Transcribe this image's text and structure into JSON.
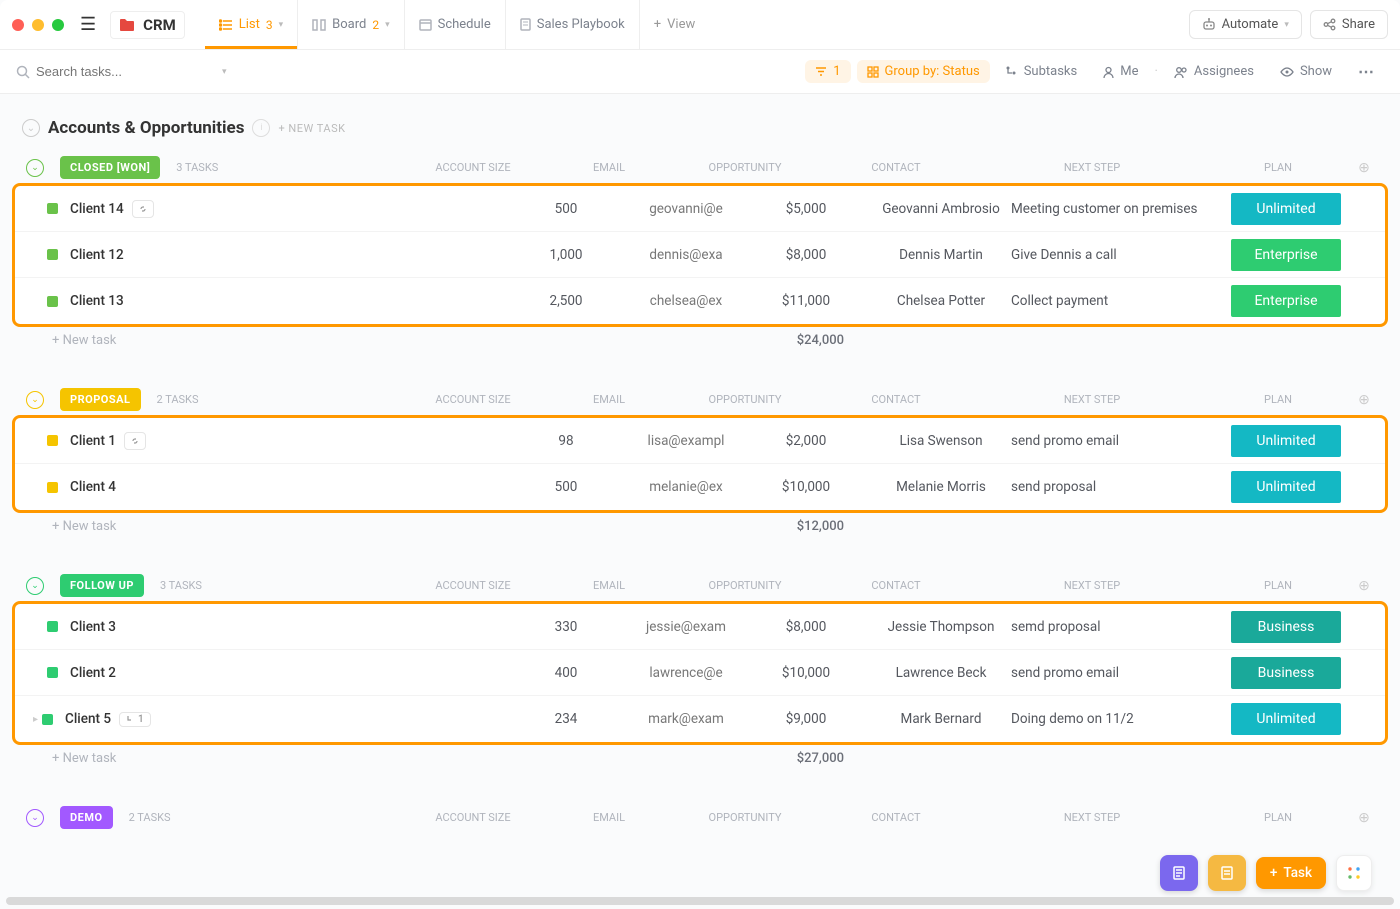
{
  "header": {
    "folder_name": "CRM",
    "views": {
      "list": {
        "label": "List",
        "count": "3"
      },
      "board": {
        "label": "Board",
        "count": "2"
      },
      "schedule": {
        "label": "Schedule"
      },
      "playbook": {
        "label": "Sales Playbook"
      },
      "addview": "View"
    },
    "automate_label": "Automate",
    "share_label": "Share"
  },
  "filter": {
    "search_placeholder": "Search tasks...",
    "filter_count": "1",
    "group_by": "Group by: Status",
    "subtasks": "Subtasks",
    "me": "Me",
    "assignees": "Assignees",
    "show": "Show"
  },
  "page": {
    "title": "Accounts & Opportunities",
    "new_task_btn": "+ NEW TASK"
  },
  "cols": {
    "acct": "ACCOUNT SIZE",
    "email": "EMAIL",
    "opp": "OPPORTUNITY",
    "contact": "CONTACT",
    "next": "NEXT STEP",
    "plan": "PLAN"
  },
  "groups": [
    {
      "key": "closedwon",
      "status": "CLOSED [WON]",
      "status_color": "#6ac24a",
      "collapse_color": "#6ac24a",
      "tasks_label": "3 TASKS",
      "rows": [
        {
          "name": "Client 14",
          "link": true,
          "acct": "500",
          "email": "geovanni@e",
          "opp": "$5,000",
          "contact": "Geovanni Ambrosio",
          "next": "Meeting customer on premises",
          "plan": "Unlimited",
          "plan_type": "unlimited",
          "sq": "#6ac24a"
        },
        {
          "name": "Client 12",
          "acct": "1,000",
          "email": "dennis@exa",
          "opp": "$8,000",
          "contact": "Dennis Martin",
          "next": "Give Dennis a call",
          "plan": "Enterprise",
          "plan_type": "enterprise",
          "sq": "#6ac24a"
        },
        {
          "name": "Client 13",
          "acct": "2,500",
          "email": "chelsea@ex",
          "opp": "$11,000",
          "contact": "Chelsea Potter",
          "next": "Collect payment",
          "plan": "Enterprise",
          "plan_type": "enterprise",
          "sq": "#6ac24a"
        }
      ],
      "new_task": "+ New task",
      "total": "$24,000"
    },
    {
      "key": "proposal",
      "status": "PROPOSAL",
      "status_color": "#f5c400",
      "collapse_color": "#f5c400",
      "tasks_label": "2 TASKS",
      "rows": [
        {
          "name": "Client 1",
          "link": true,
          "acct": "98",
          "email": "lisa@exampl",
          "opp": "$2,000",
          "contact": "Lisa Swenson",
          "next": "send promo email",
          "plan": "Unlimited",
          "plan_type": "unlimited",
          "sq": "#f5c400"
        },
        {
          "name": "Client 4",
          "acct": "500",
          "email": "melanie@ex",
          "opp": "$10,000",
          "contact": "Melanie Morris",
          "next": "send proposal",
          "plan": "Unlimited",
          "plan_type": "unlimited",
          "sq": "#f5c400"
        }
      ],
      "new_task": "+ New task",
      "total": "$12,000"
    },
    {
      "key": "followup",
      "status": "FOLLOW UP",
      "status_color": "#2ecc71",
      "collapse_color": "#2ecc71",
      "tasks_label": "3 TASKS",
      "rows": [
        {
          "name": "Client 3",
          "acct": "330",
          "email": "jessie@exam",
          "opp": "$8,000",
          "contact": "Jessie Thompson",
          "next": "semd proposal",
          "plan": "Business",
          "plan_type": "business",
          "sq": "#2ecc71"
        },
        {
          "name": "Client 2",
          "acct": "400",
          "email": "lawrence@e",
          "opp": "$10,000",
          "contact": "Lawrence Beck",
          "next": "send promo email",
          "plan": "Business",
          "plan_type": "business",
          "sq": "#2ecc71"
        },
        {
          "name": "Client 5",
          "sub": "1",
          "caret": true,
          "acct": "234",
          "email": "mark@exam",
          "opp": "$9,000",
          "contact": "Mark Bernard",
          "next": "Doing demo on 11/2",
          "plan": "Unlimited",
          "plan_type": "unlimited",
          "sq": "#2ecc71"
        }
      ],
      "new_task": "+ New task",
      "total": "$27,000"
    },
    {
      "key": "demo",
      "status": "DEMO",
      "status_color": "#a259ff",
      "collapse_color": "#a259ff",
      "tasks_label": "2 TASKS",
      "rows": [],
      "new_task": "",
      "total": ""
    }
  ],
  "dock": {
    "task_label": "Task"
  }
}
